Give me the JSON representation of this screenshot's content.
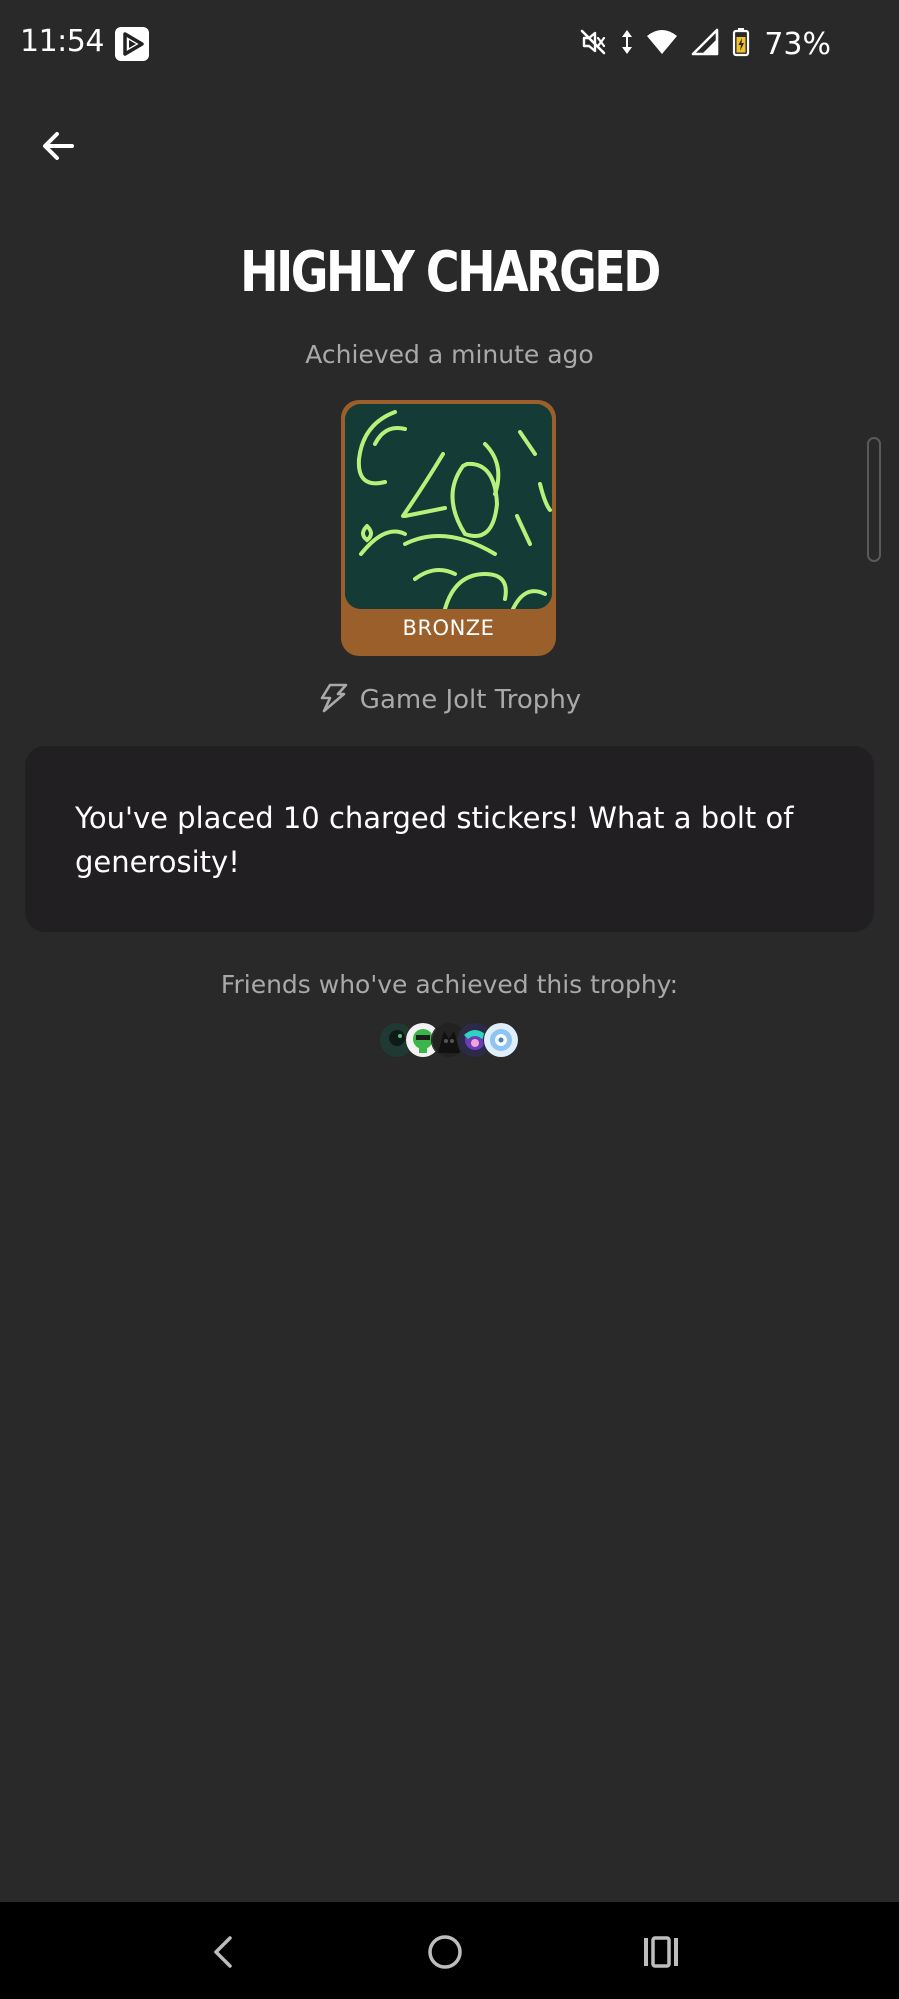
{
  "status_bar": {
    "time": "11:54",
    "battery_percent": "73%",
    "icons": [
      "play-store-icon",
      "mute-icon",
      "data-arrows-icon",
      "wifi-icon",
      "signal-icon",
      "battery-icon"
    ]
  },
  "header": {
    "back_icon": "arrow-left-icon"
  },
  "trophy": {
    "title": "HIGHLY CHARGED",
    "achieved": "Achieved a minute ago",
    "tier": "BRONZE",
    "tier_color": "#9a5f2a",
    "image_bg_color": "#153b37",
    "image_accent_color": "#b6f27a",
    "source_icon": "lightning-bolt-icon",
    "source": "Game Jolt Trophy",
    "description": "You've placed 10 charged stickers! What a bolt of generosity!"
  },
  "friends": {
    "label": "Friends who've achieved this trophy:",
    "avatars": [
      {
        "name": "friend-avatar-1",
        "color": "#1f3a33"
      },
      {
        "name": "friend-avatar-2",
        "color": "#3bb54a"
      },
      {
        "name": "friend-avatar-3",
        "color": "#222222"
      },
      {
        "name": "friend-avatar-4",
        "color": "#6a3db8"
      },
      {
        "name": "friend-avatar-5",
        "color": "#8fc3f0"
      }
    ]
  },
  "nav_bar": {
    "back_icon": "nav-back-icon",
    "home_icon": "nav-home-icon",
    "recents_icon": "nav-recents-icon"
  },
  "colors": {
    "background": "#292929",
    "card": "#211f22",
    "muted_text": "#a9a9a9"
  }
}
